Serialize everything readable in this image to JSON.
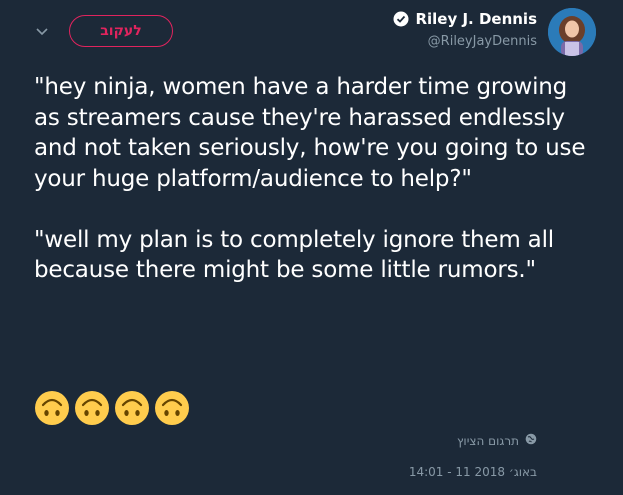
{
  "header": {
    "follow_label": "לעקוב",
    "author_name": "Riley J. Dennis",
    "author_handle": "@RileyJayDennis"
  },
  "tweet": {
    "text": "\"hey ninja, women have a harder time growing as streamers cause they're harassed endlessly and not taken seriously, how're you going to use your huge platform/audience to help?\"\n\n\"well my plan is to completely ignore them all because there might be some little rumors.\"",
    "emojis": [
      "upside-down-face",
      "upside-down-face",
      "upside-down-face",
      "upside-down-face"
    ]
  },
  "footer": {
    "translate_label": "תרגום הציוץ",
    "timestamp": "14:01 - 11 באוג׳ 2018"
  },
  "colors": {
    "background": "#1c2938",
    "accent": "#e0245e",
    "muted": "#8899a6"
  }
}
